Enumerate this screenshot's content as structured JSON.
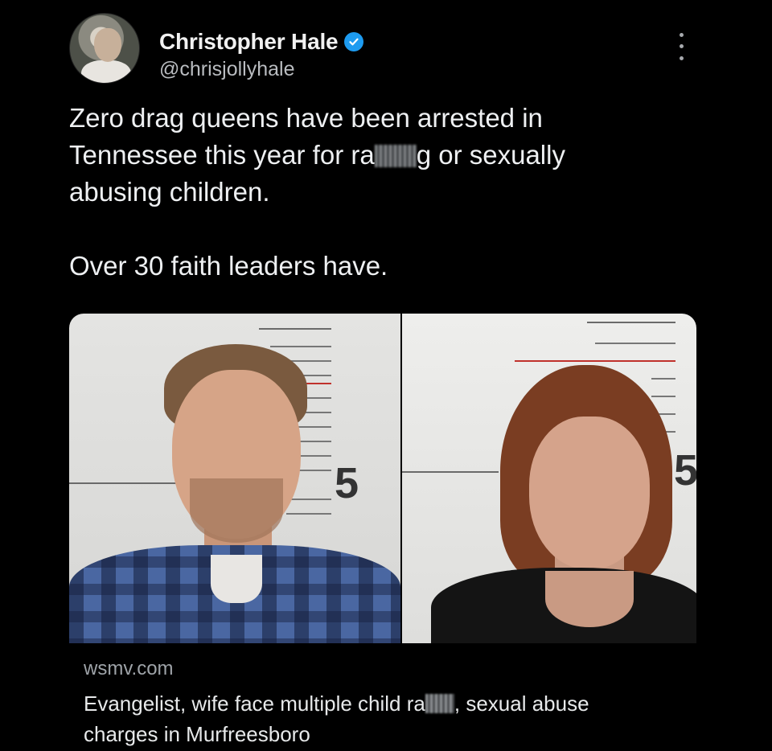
{
  "tweet": {
    "author": {
      "display_name": "Christopher Hale",
      "handle": "@chrisjollyhale",
      "verified_icon": "verified-badge-icon",
      "verified_color": "#1d9bf0"
    },
    "more_icon": "more-options-icon",
    "text": {
      "line1": "Zero drag queens have been arrested in",
      "line2_before": "Tennessee this year for ra",
      "line2_after": "g or sexually",
      "line3": "abusing children.",
      "paragraph2": "Over 30 faith leaders have."
    }
  },
  "card": {
    "height_marker_left": "5",
    "height_marker_right": "5",
    "domain": "wsmv.com",
    "title_before": "Evangelist, wife face multiple child ra",
    "title_after": ", sexual abuse",
    "title_line2": "charges in Murfreesboro"
  },
  "colors": {
    "background": "#000000",
    "text": "#e7e9ea",
    "secondary_text": "#9ea3a8"
  }
}
